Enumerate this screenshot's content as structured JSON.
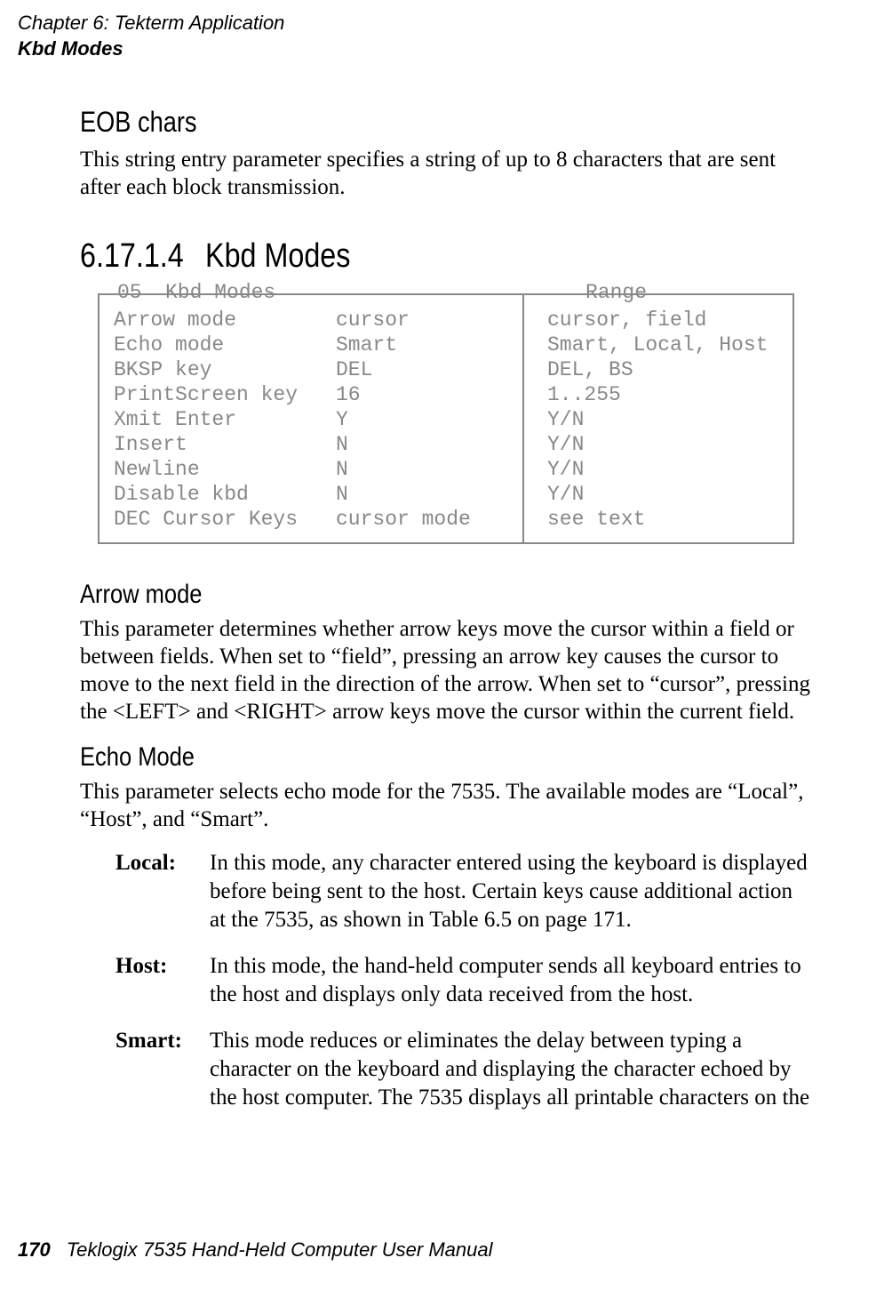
{
  "header": {
    "chapter_line": "Chapter  6:  Tekterm Application",
    "section_line": "Kbd Modes"
  },
  "eob": {
    "title": "EOB chars",
    "para": "This string entry parameter specifies a string of up to 8 characters that are sent after each block transmission."
  },
  "kbdmodes": {
    "secnum": "6.17.1.4",
    "title": "Kbd Modes",
    "legend_num": "05",
    "legend_title": "Kbd Modes",
    "legend_range": "Range",
    "rows": [
      {
        "name": "Arrow mode",
        "value": "cursor",
        "range": "cursor, field"
      },
      {
        "name": "Echo mode",
        "value": "Smart",
        "range": "Smart, Local, Host"
      },
      {
        "name": "BKSP key",
        "value": "DEL",
        "range": "DEL, BS"
      },
      {
        "name": "PrintScreen key",
        "value": "16",
        "range": "1..255"
      },
      {
        "name": "Xmit Enter",
        "value": "Y",
        "range": "Y/N"
      },
      {
        "name": "Insert",
        "value": "N",
        "range": "Y/N"
      },
      {
        "name": "Newline",
        "value": "N",
        "range": "Y/N"
      },
      {
        "name": "Disable kbd",
        "value": "N",
        "range": "Y/N"
      },
      {
        "name": "DEC Cursor Keys",
        "value": "cursor mode",
        "range": "see text"
      }
    ]
  },
  "arrow": {
    "title": "Arrow mode",
    "para": "This parameter determines whether arrow keys move the cursor within a field or between fields. When set to “field”, pressing an arrow key causes the cursor to move to the next field in the direction of the arrow. When set to “cursor”, pressing the <LEFT> and <RIGHT> arrow keys move the cursor within the current field."
  },
  "echo": {
    "title": "Echo Mode",
    "intro": "This parameter selects echo mode for the 7535. The available modes are “Local”, “Host”, and “Smart”.",
    "items": [
      {
        "term": "Local:",
        "desc": "In this mode, any character entered using the keyboard is displayed before being sent to the host. Certain keys cause additional action at the 7535, as shown in Table 6.5 on page 171."
      },
      {
        "term": "Host:",
        "desc": "In this mode, the hand-held computer sends all keyboard entries to the host and displays only data received from the host."
      },
      {
        "term": "Smart:",
        "desc": "This mode reduces or eliminates the delay between typing a character on the keyboard and displaying the character echoed by the host computer. The 7535 displays all printable characters on the"
      }
    ]
  },
  "footer": {
    "page": "170",
    "title": "Teklogix 7535 Hand-Held Computer User Manual"
  }
}
